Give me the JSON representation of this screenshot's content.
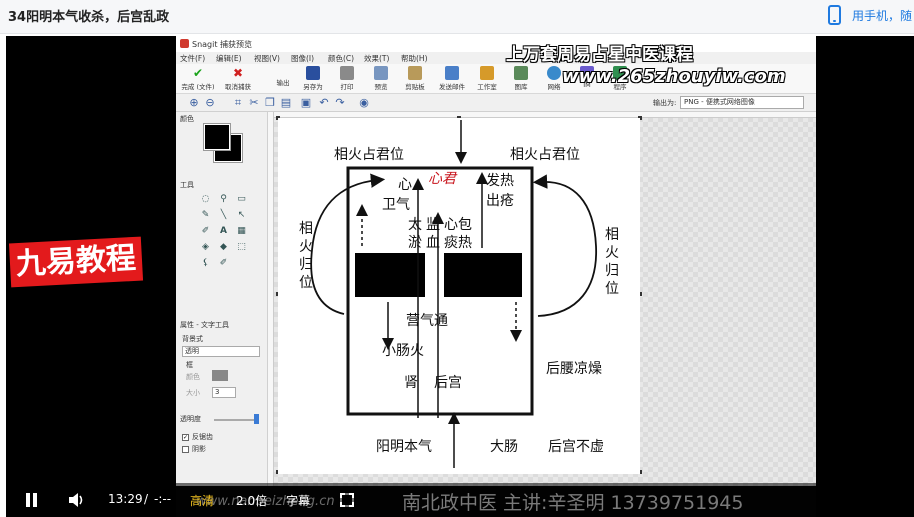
{
  "page": {
    "title": "34阳明本气收杀，后宫乱政",
    "phone_link": "用手机，随"
  },
  "video": {
    "brand": "九易教程",
    "watermark_title": "上万套周易占星中医课程",
    "watermark_url": "www.265zhouyiw.com",
    "lecturer_line": "南北政中医  主讲:辛圣明  13739751945",
    "site_url": "www.nanbeizheng.cn"
  },
  "player": {
    "current_time": "13:29",
    "separator": "/",
    "duration": "-:--",
    "quality": "高清",
    "speed": "2.0倍",
    "subtitles": "字幕"
  },
  "snagit": {
    "title": "Snagit 捕获预览",
    "menu": [
      "文件(F)",
      "编辑(E)",
      "视图(V)",
      "图像(I)",
      "颜色(C)",
      "效果(T)",
      "帮助(H)"
    ],
    "ribbon": [
      {
        "label": "完成 (文件)",
        "icon": "check-icon"
      },
      {
        "label": "取消捕获",
        "icon": "cancel-icon"
      },
      {
        "label": "输出",
        "icon": "none"
      },
      {
        "label": "另存为",
        "icon": "save-icon"
      },
      {
        "label": "打印",
        "icon": "print-icon"
      },
      {
        "label": "预览",
        "icon": "preview-icon"
      },
      {
        "label": "剪贴板",
        "icon": "clipboard-icon"
      },
      {
        "label": "发送邮件",
        "icon": "mail-icon"
      },
      {
        "label": "工作室",
        "icon": "studio-icon"
      },
      {
        "label": "图库",
        "icon": "gallery-icon"
      },
      {
        "label": "网络",
        "icon": "web-icon"
      },
      {
        "label": "IM",
        "icon": "im-icon"
      },
      {
        "label": "程序",
        "icon": "program-icon"
      }
    ],
    "output_label": "输出为:",
    "output_format": "PNG - 便携式网络图像",
    "panel": {
      "color_heading": "颜色",
      "tools_heading": "工具",
      "properties_heading": "属性 - 文字工具",
      "bg_style_label": "背景式",
      "bg_style_value": "透明",
      "border_label": "框",
      "color_label": "颜色",
      "size_label": "大小",
      "size_value": "3",
      "opacity_label": "透明度",
      "antialias_label": "反锯齿",
      "shadow_label": "阴影"
    }
  },
  "diagram": {
    "top_left": "相火占君位",
    "top_right": "相火占君位",
    "left_vertical": "相火归位",
    "right_vertical": "相火归位",
    "xin": "心",
    "xin_jun": "心君",
    "fa_re": "发热",
    "chu_chuang": "出疮",
    "wei_qi": "卫气",
    "tai": "太",
    "jian": "监",
    "xin_bao": "心包",
    "yu": "淤",
    "xue": "血",
    "tan_re": "痰热",
    "ying_qi_tong": "营气通",
    "xiao_chang_huo": "小肠火",
    "shen": "肾",
    "hou_gong": "后宫",
    "hou_yao": "后腰凉燥",
    "yang_ming": "阳明本气",
    "da_chang": "大肠",
    "hou_gong_bu_xu": "后宫不虚"
  }
}
